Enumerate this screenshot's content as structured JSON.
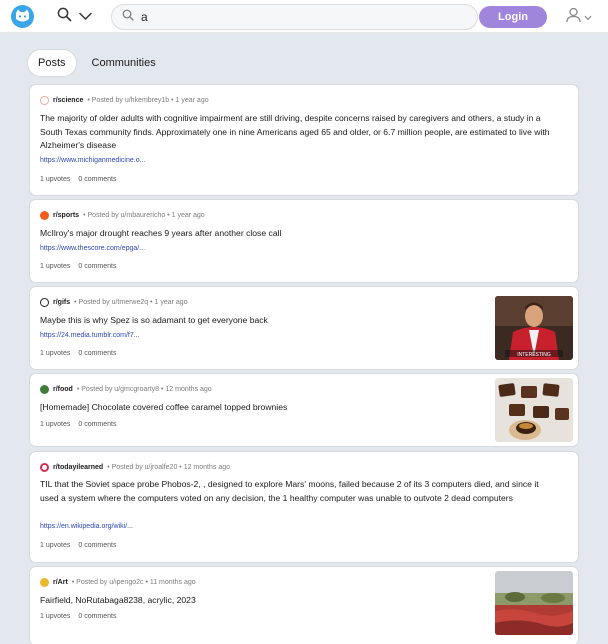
{
  "header": {
    "search_value": "a",
    "login_label": "Login"
  },
  "tabs": [
    {
      "label": "Posts"
    },
    {
      "label": "Communities"
    }
  ],
  "posts": [
    {
      "subreddit": "r/science",
      "meta": "• Posted by u/hkembrey1b • 1 year ago",
      "title": "The majority of older adults with cognitive impairment are still driving, despite concerns raised by caregivers and others, a study in a South Texas community finds. Approximately one in nine Americans aged 65 and older, or 6.7 million people, are estimated to live with Alzheimer's disease",
      "link": "https://www.michiganmedicine.o...",
      "upvotes": "1 upvotes",
      "comments": "0 comments",
      "icon_color": "#f4a79d"
    },
    {
      "subreddit": "r/sports",
      "meta": "• Posted by u/mbaurericho • 1 year ago",
      "title": "McIlroy's major drought reaches 9 years after another close call",
      "link": "https://www.thescore.com/epga/...",
      "upvotes": "1 upvotes",
      "comments": "0 comments",
      "icon_color": "#f25c1f"
    },
    {
      "subreddit": "r/gifs",
      "meta": "• Posted by u/tmerwe2q • 1 year ago",
      "title": "Maybe this is why Spez is so adamant to get everyone back",
      "link": "https://24.media.tumblr.com/f7...",
      "upvotes": "1 upvotes",
      "comments": "0 comments",
      "icon_color": "#222222",
      "thumb_caption": "INTERESTING"
    },
    {
      "subreddit": "r/food",
      "meta": "• Posted by u/gmcgroarty8 • 12 months ago",
      "title": "[Homemade] Chocolate covered coffee caramel topped brownies",
      "upvotes": "1 upvotes",
      "comments": "0 comments",
      "icon_color": "#3e7d3a"
    },
    {
      "subreddit": "r/todayilearned",
      "meta": "• Posted by u/jroalfe20 • 12 months ago",
      "title": "TIL that the Soviet space probe Phobos-2, , designed to explore Mars' moons, failed because 2 of its 3 computers died, and since it used a system where the computers voted on any decision, the 1 healthy computer was unable to outvote 2 dead computers",
      "link": "https://en.wikipedia.org/wiki/...",
      "upvotes": "1 upvotes",
      "comments": "0 comments",
      "icon_color": "#d62d4f"
    },
    {
      "subreddit": "r/Art",
      "meta": "• Posted by u/iperigo2c • 11 months ago",
      "title": "Fairfield, NoRutabaga8238, acrylic, 2023",
      "upvotes": "1 upvotes",
      "comments": "0 comments",
      "icon_color": "#e8b82f"
    }
  ]
}
